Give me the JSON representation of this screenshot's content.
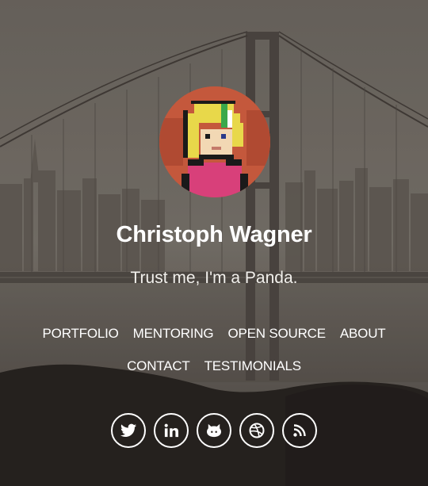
{
  "profile": {
    "name": "Christoph Wagner",
    "tagline": "Trust me, I'm a Panda."
  },
  "nav": {
    "row1": [
      "PORTFOLIO",
      "MENTORING",
      "OPEN SOURCE",
      "ABOUT"
    ],
    "row2": [
      "CONTACT",
      "TESTIMONIALS"
    ]
  },
  "social": [
    {
      "icon": "twitter-icon"
    },
    {
      "icon": "linkedin-icon"
    },
    {
      "icon": "github-icon"
    },
    {
      "icon": "dribbble-icon"
    },
    {
      "icon": "rss-icon"
    }
  ],
  "colors": {
    "text": "#ffffff",
    "overlay": "#5a554f"
  }
}
